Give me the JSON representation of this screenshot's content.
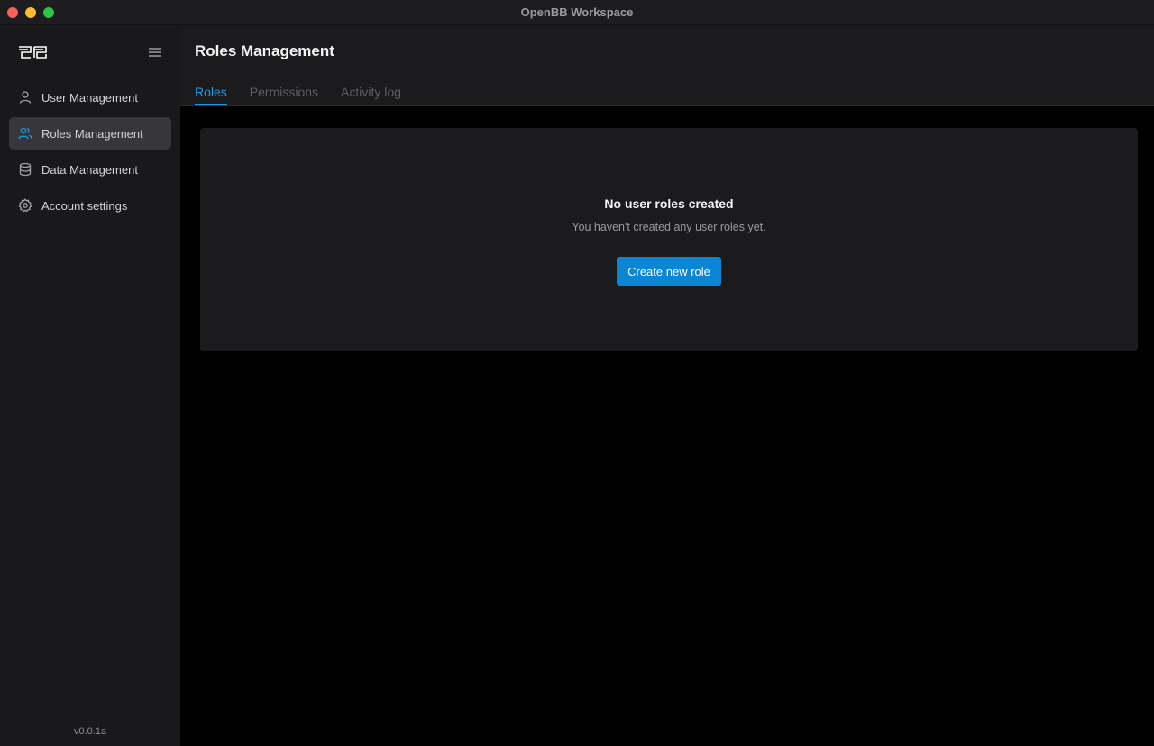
{
  "window": {
    "title": "OpenBB Workspace"
  },
  "sidebar": {
    "items": [
      {
        "label": "User Management",
        "icon": "user-icon",
        "active": false
      },
      {
        "label": "Roles Management",
        "icon": "users-icon",
        "active": true
      },
      {
        "label": "Data Management",
        "icon": "database-icon",
        "active": false
      },
      {
        "label": "Account settings",
        "icon": "gear-icon",
        "active": false
      }
    ],
    "version": "v0.0.1a"
  },
  "header": {
    "title": "Roles Management",
    "tabs": [
      {
        "label": "Roles",
        "active": true
      },
      {
        "label": "Permissions",
        "active": false
      },
      {
        "label": "Activity log",
        "active": false
      }
    ]
  },
  "empty_state": {
    "title": "No user roles created",
    "subtitle": "You haven't created any user roles yet.",
    "button_label": "Create new role"
  },
  "colors": {
    "accent": "#1f9be6",
    "button": "#0a86d4",
    "sidebar_bg": "#19191c",
    "active_item_bg": "#36363b"
  }
}
